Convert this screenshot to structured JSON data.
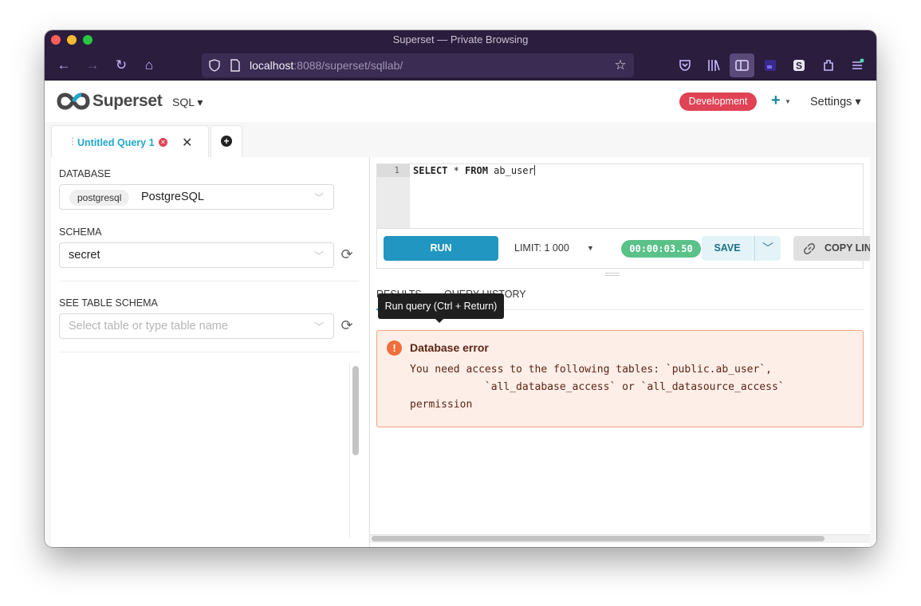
{
  "window": {
    "title": "Superset — Private Browsing",
    "traffic_colors": [
      "#fe5f57",
      "#febc2e",
      "#28c840"
    ]
  },
  "browser": {
    "url_host": "localhost",
    "url_path": ":8088/superset/sqllab/",
    "back_icon": "←",
    "forward_icon": "→",
    "reload_icon": "↻",
    "home_icon": "⌂",
    "bookmark_icon": "☆"
  },
  "nav": {
    "brand": "Superset",
    "sql_menu": "SQL ▾",
    "env_badge": "Development",
    "plus_menu": "+",
    "settings_menu": "Settings ▾",
    "badge_color": "#e04355"
  },
  "tabs": {
    "active_label": "Untitled Query 1",
    "close_icon": "✕",
    "add_icon": "+"
  },
  "left": {
    "database_label": "DATABASE",
    "database_tag": "postgresql",
    "database_value": "PostgreSQL",
    "schema_label": "SCHEMA",
    "schema_value": "secret",
    "table_label": "SEE TABLE SCHEMA",
    "table_placeholder": "Select table or type table name"
  },
  "editor": {
    "line_number": "1",
    "sql_kw1": "SELECT",
    "sql_mid": " * ",
    "sql_kw2": "FROM",
    "sql_rest": " ab_user"
  },
  "controls": {
    "tooltip": "Run query (Ctrl + Return)",
    "run": "RUN",
    "limit": "LIMIT:  1 000",
    "timer": "00:00:03.50",
    "save": "SAVE",
    "copy": "COPY LIN",
    "accent": "#2096c0",
    "timer_color": "#5ac189"
  },
  "results": {
    "tab_results": "RESULTS",
    "tab_history": "QUERY HISTORY",
    "error_title": "Database error",
    "error_line1": "You need access to the following tables: `public.ab_user`,",
    "error_line2": "            `all_database_access` or `all_datasource_access`",
    "error_line3": "permission"
  }
}
